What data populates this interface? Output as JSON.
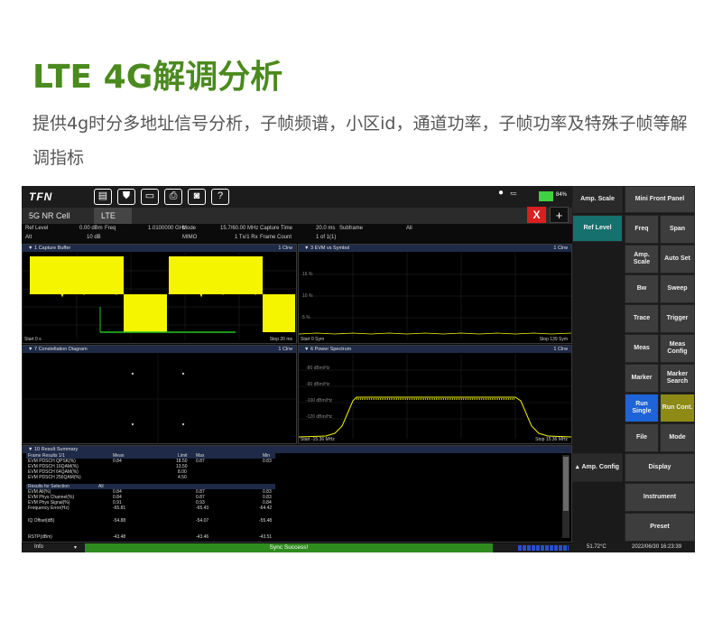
{
  "heading": {
    "title": "LTE 4G解调分析",
    "description": "提供4g时分多地址信号分析，子帧频谱，小区id，通道功率，子帧功率及特殊子帧等解调指标"
  },
  "app": {
    "logo": "TFN",
    "battery_text": "84%",
    "tabs": [
      "5G NR Cell",
      "LTE"
    ],
    "close_label": "X",
    "add_label": "+"
  },
  "params": {
    "row1": [
      "Ref Level",
      "0.00 dBm",
      "Freq",
      "1.0100000 GHz",
      "Mode",
      "15.7/60.00 MHz",
      "Capture Time",
      "20.0 ms",
      "Subframe",
      "All"
    ],
    "row2": [
      "Att",
      "10 dB",
      "MIMO",
      "1 Tx/1 Rx",
      "Frame Count",
      "1 of 1(1)"
    ]
  },
  "panes": {
    "capture": {
      "title": "1 Capture Buffer",
      "clrw": "1 Clrw",
      "foot_left": "Start  0 s",
      "foot_right": "Stop  20 ms"
    },
    "evm": {
      "title": "3 EVM vs Symbol",
      "clrw": "1 Clrw",
      "ticks": [
        "15 %",
        "10 %",
        "5 %"
      ],
      "foot_left": "Start  0 Sym",
      "foot_right": "Stop  139 Sym"
    },
    "constellation": {
      "title": "7 Constellation Diagram",
      "clrw": "1 Clrw"
    },
    "spectrum": {
      "title": "6 Power Spectrum",
      "clrw": "1 Clrw",
      "ticks": [
        "-80 dBm/Hz",
        "-90 dBm/Hz",
        "-100 dBm/Hz",
        "-110 dBm/Hz",
        "-120 dBm/Hz"
      ],
      "foot_left": "Start  -15.36 MHz",
      "foot_right": "Stop  15.36 MHz"
    },
    "result": {
      "title": "10 Result Summary"
    }
  },
  "result_table": {
    "header": [
      "Frame Results 1/1",
      "Mean",
      "Limit",
      "Max",
      "Min"
    ],
    "rows1": [
      [
        "EVM PDSCH QPSK(%)",
        "0.84",
        "18.50",
        "0.87",
        "0.83"
      ],
      [
        "EVM PDSCH 16QAM(%)",
        "",
        "13.50",
        "",
        ""
      ],
      [
        "EVM PDSCH 64QAM(%)",
        "",
        "8.00",
        "",
        ""
      ],
      [
        "EVM PDSCH 256QAM(%)",
        "",
        "4.50",
        "",
        ""
      ]
    ],
    "header2": [
      "Results for Selection",
      "All"
    ],
    "rows2": [
      [
        "EVM All(%)",
        "0.84",
        "",
        "0.87",
        "0.83"
      ],
      [
        "EVM Phys Channel(%)",
        "0.84",
        "",
        "0.87",
        "0.83"
      ],
      [
        "EVM Phys Signal(%)",
        "0.91",
        "",
        "0.93",
        "0.84"
      ],
      [
        "Frequency Error(Hz)",
        "-65.81",
        "",
        "-65.43",
        "-64.42"
      ],
      [
        "IQ Offset(dB)",
        "-54.88",
        "",
        "-54.07",
        "-55.48"
      ],
      [
        "RSTP(dBm)",
        "-43.48",
        "",
        "-43.46",
        "-43.51"
      ]
    ]
  },
  "sidebar": {
    "amp_scale_top": "Amp. Scale",
    "mini_front_panel": "Mini Front Panel",
    "ref_level": "Ref Level",
    "freq": "Freq",
    "span": "Span",
    "amp_scale": "Amp. Scale",
    "auto_set": "Auto Set",
    "bw": "Bw",
    "sweep": "Sweep",
    "trace": "Trace",
    "trigger": "Trigger",
    "meas": "Meas",
    "meas_config": "Meas Config",
    "marker": "Marker",
    "marker_search": "Marker Search",
    "run_single": "Run Single",
    "run_cont": "Run Cont.",
    "file": "File",
    "mode": "Mode",
    "amp_config": "Amp. Config",
    "display": "Display",
    "instrument": "Instrument",
    "preset": "Preset"
  },
  "status": {
    "info": "Info",
    "sync": "Sync Success!",
    "temp": "51.72°C",
    "datetime": "2022/06/30 16:23:39"
  },
  "colors": {
    "title_green": "#4b8a1e",
    "trace_yellow": "#f5f500",
    "run_blue": "#1e63d8",
    "run_cont_olive": "#8d8a16",
    "ref_teal": "#16706e",
    "sync_green": "#2e8b1d"
  }
}
